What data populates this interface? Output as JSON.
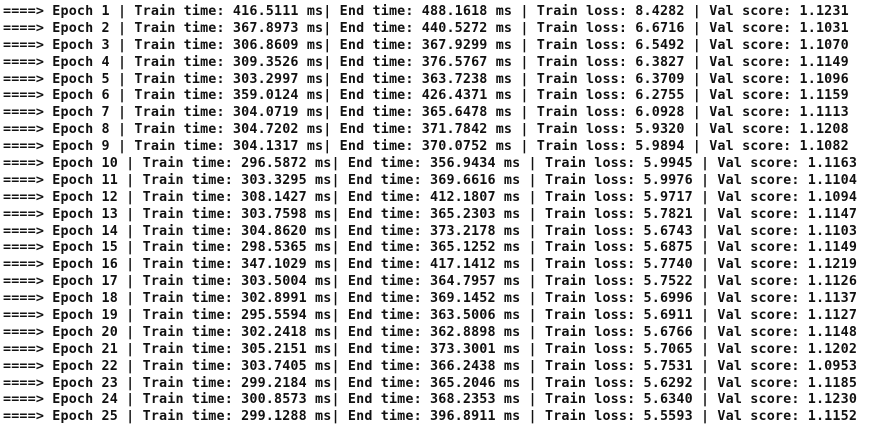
{
  "log": {
    "lines": [
      "====> Epoch 1 | Train time: 416.5111 ms| End time: 488.1618 ms | Train loss: 8.4282 | Val score: 1.1231",
      "====> Epoch 2 | Train time: 367.8973 ms| End time: 440.5272 ms | Train loss: 6.6716 | Val score: 1.1031",
      "====> Epoch 3 | Train time: 306.8609 ms| End time: 367.9299 ms | Train loss: 6.5492 | Val score: 1.1070",
      "====> Epoch 4 | Train time: 309.3526 ms| End time: 376.5767 ms | Train loss: 6.3827 | Val score: 1.1149",
      "====> Epoch 5 | Train time: 303.2997 ms| End time: 363.7238 ms | Train loss: 6.3709 | Val score: 1.1096",
      "====> Epoch 6 | Train time: 359.0124 ms| End time: 426.4371 ms | Train loss: 6.2755 | Val score: 1.1159",
      "====> Epoch 7 | Train time: 304.0719 ms| End time: 365.6478 ms | Train loss: 6.0928 | Val score: 1.1113",
      "====> Epoch 8 | Train time: 304.7202 ms| End time: 371.7842 ms | Train loss: 5.9320 | Val score: 1.1208",
      "====> Epoch 9 | Train time: 304.1317 ms| End time: 370.0752 ms | Train loss: 5.9894 | Val score: 1.1082",
      "====> Epoch 10 | Train time: 296.5872 ms| End time: 356.9434 ms | Train loss: 5.9945 | Val score: 1.1163",
      "====> Epoch 11 | Train time: 303.3295 ms| End time: 369.6616 ms | Train loss: 5.9976 | Val score: 1.1104",
      "====> Epoch 12 | Train time: 308.1427 ms| End time: 412.1807 ms | Train loss: 5.9717 | Val score: 1.1094",
      "====> Epoch 13 | Train time: 303.7598 ms| End time: 365.2303 ms | Train loss: 5.7821 | Val score: 1.1147",
      "====> Epoch 14 | Train time: 304.8620 ms| End time: 373.2178 ms | Train loss: 5.6743 | Val score: 1.1103",
      "====> Epoch 15 | Train time: 298.5365 ms| End time: 365.1252 ms | Train loss: 5.6875 | Val score: 1.1149",
      "====> Epoch 16 | Train time: 347.1029 ms| End time: 417.1412 ms | Train loss: 5.7740 | Val score: 1.1219",
      "====> Epoch 17 | Train time: 303.5004 ms| End time: 364.7957 ms | Train loss: 5.7522 | Val score: 1.1126",
      "====> Epoch 18 | Train time: 302.8991 ms| End time: 369.1452 ms | Train loss: 5.6996 | Val score: 1.1137",
      "====> Epoch 19 | Train time: 295.5594 ms| End time: 363.5006 ms | Train loss: 5.6911 | Val score: 1.1127",
      "====> Epoch 20 | Train time: 302.2418 ms| End time: 362.8898 ms | Train loss: 5.6766 | Val score: 1.1148",
      "====> Epoch 21 | Train time: 305.2151 ms| End time: 373.3001 ms | Train loss: 5.7065 | Val score: 1.1202",
      "====> Epoch 22 | Train time: 303.7405 ms| End time: 366.2438 ms | Train loss: 5.7531 | Val score: 1.0953",
      "====> Epoch 23 | Train time: 299.2184 ms| End time: 365.2046 ms | Train loss: 5.6292 | Val score: 1.1185",
      "====> Epoch 24 | Train time: 300.8573 ms| End time: 368.2353 ms | Train loss: 5.6340 | Val score: 1.1230",
      "====> Epoch 25 | Train time: 299.1288 ms| End time: 396.8911 ms | Train loss: 5.5593 | Val score: 1.1152"
    ]
  }
}
